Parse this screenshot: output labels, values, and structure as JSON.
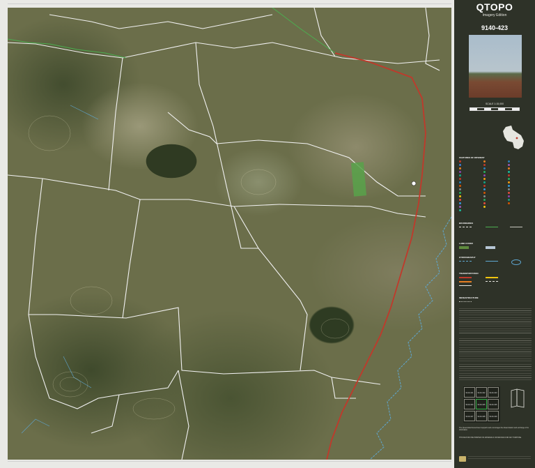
{
  "brand": {
    "title": "QTOPO",
    "edition": "Imagery Edition"
  },
  "map_id": "9140-423",
  "scale_label": "SCALE 1:15,000",
  "legend": {
    "features_heading": "FEATURES OF INTEREST",
    "boundaries_heading": "BOUNDARIES",
    "land_heading": "LAND COVER",
    "hydrography_heading": "HYDROGRAPHY",
    "transport_heading": "TRANSPORTATION",
    "infrastructure_heading": "INFRASTRUCTURE"
  },
  "index_map": {
    "cells": [
      "9140-421",
      "9140-422",
      "9140-423",
      "9140-424",
      "9140-425",
      "9140-426",
      "9140-427",
      "9140-428",
      "9140-429"
    ]
  },
  "footer": {
    "line1": "The Queensland Government supports and encourages the dissemination and exchange of its information.",
    "line2": "THIS MAP MAY BE PRINTED ON MATERIALS OR DEVICES FOR ANY PURPOSE."
  },
  "colors": {
    "panel": "#2e3228",
    "road": "#c0392b",
    "boundary": "#f2f2f2",
    "stream": "#5fa8d3",
    "green_boundary": "#4caf50"
  }
}
